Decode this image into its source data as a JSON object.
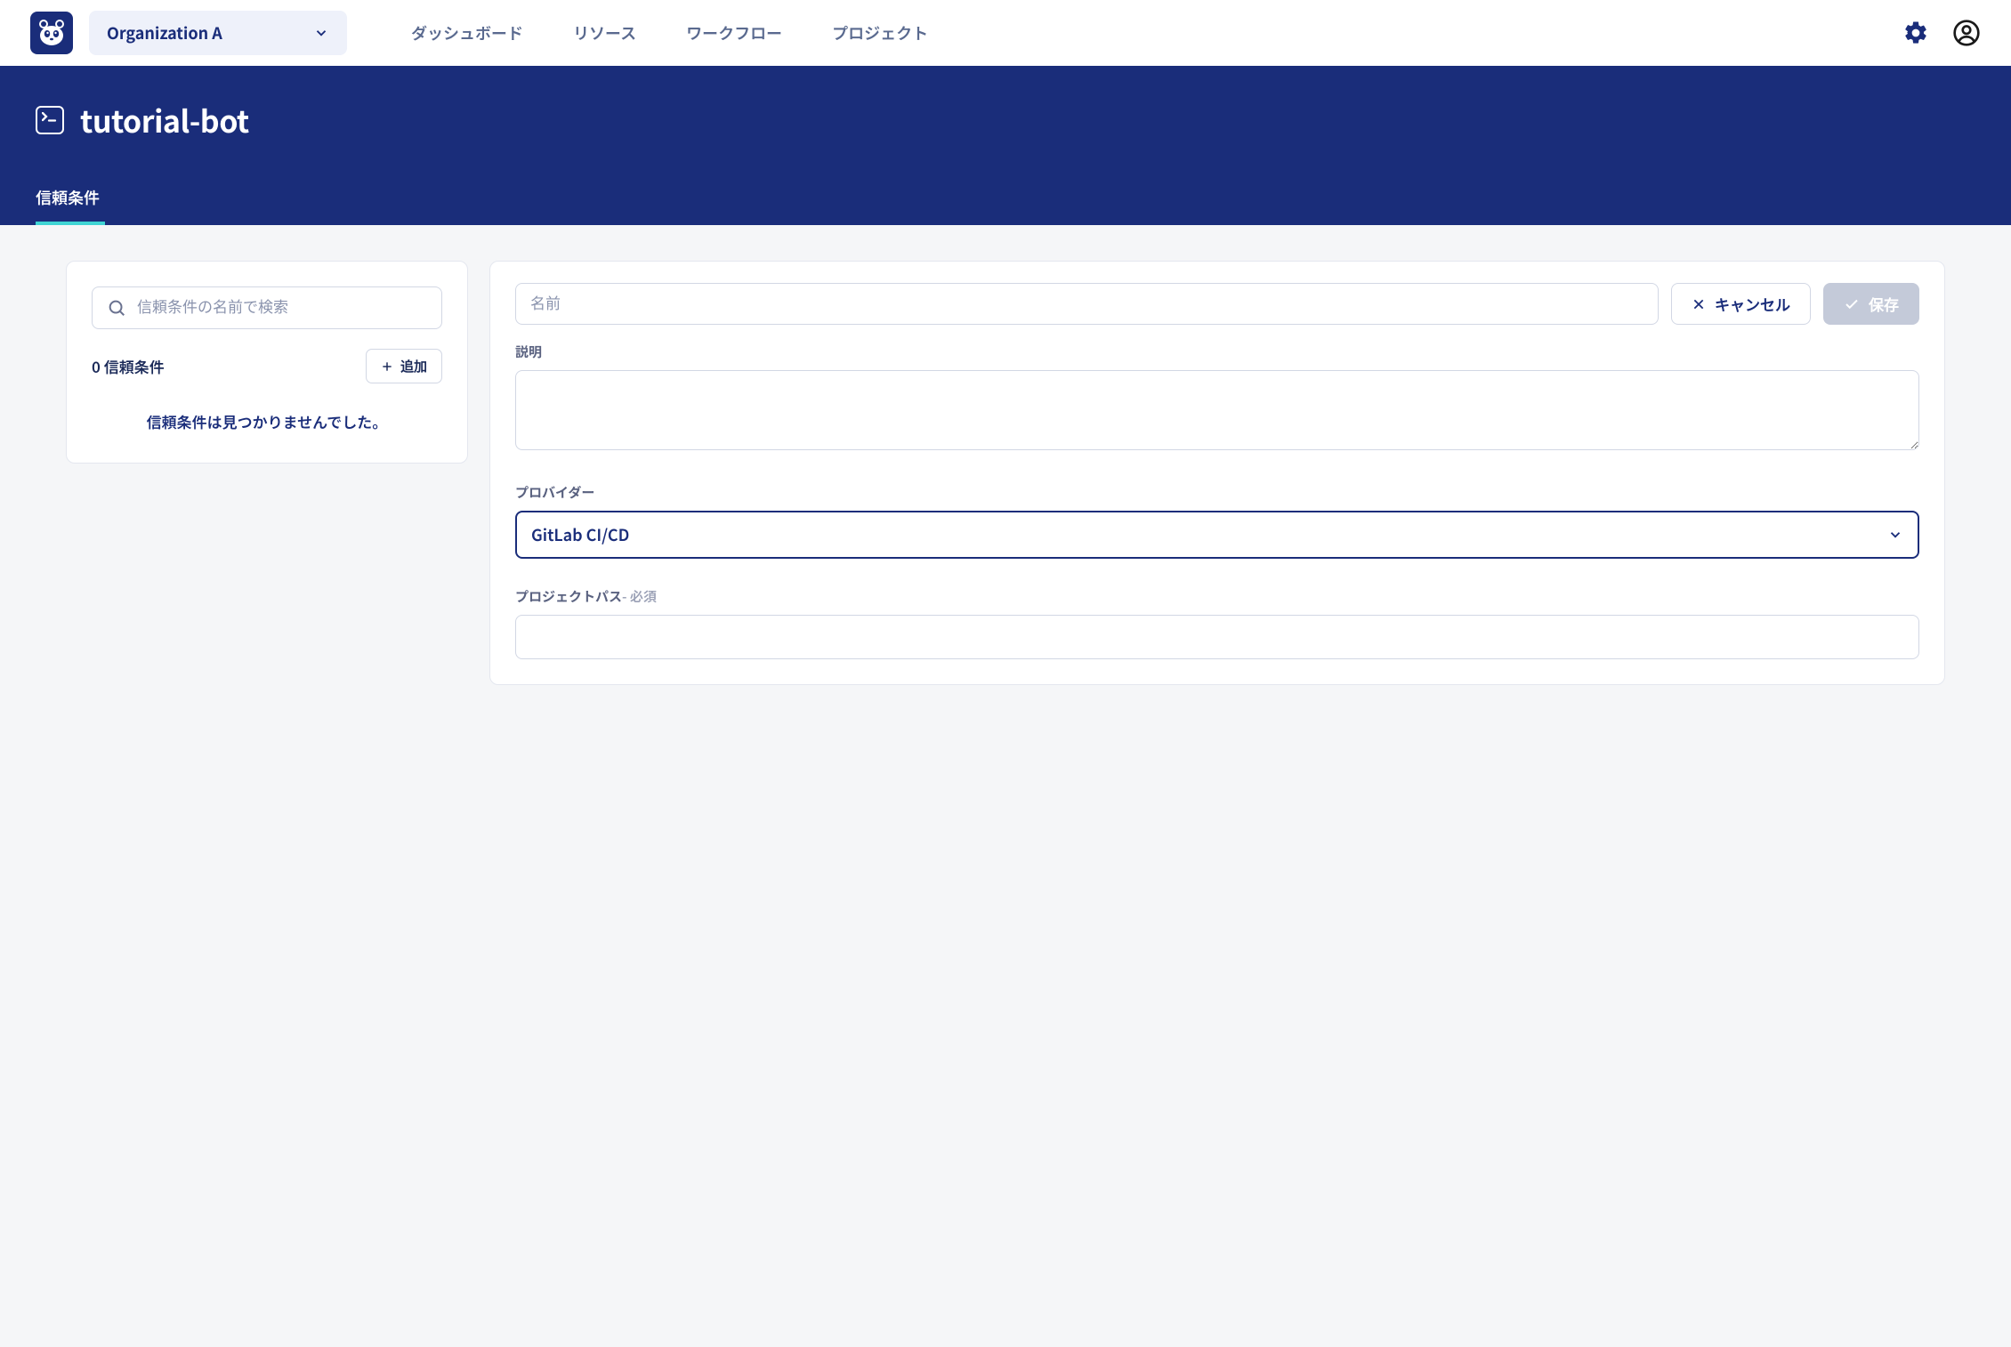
{
  "topbar": {
    "org_name": "Organization A",
    "nav": {
      "dashboard": "ダッシュボード",
      "resources": "リソース",
      "workflows": "ワークフロー",
      "projects": "プロジェクト"
    }
  },
  "header": {
    "title": "tutorial-bot",
    "tabs": {
      "trust_conditions": "信頼条件"
    }
  },
  "left_panel": {
    "search_placeholder": "信頼条件の名前で検索",
    "count_text": "0 信頼条件",
    "add_label": "追加",
    "empty_message": "信頼条件は見つかりませんでした。"
  },
  "form": {
    "name_placeholder": "名前",
    "cancel_label": "キャンセル",
    "save_label": "保存",
    "description_label": "説明",
    "provider_label": "プロバイダー",
    "provider_value": "GitLab CI/CD",
    "project_path_label": "プロジェクトパス",
    "required_suffix": "- 必須"
  }
}
